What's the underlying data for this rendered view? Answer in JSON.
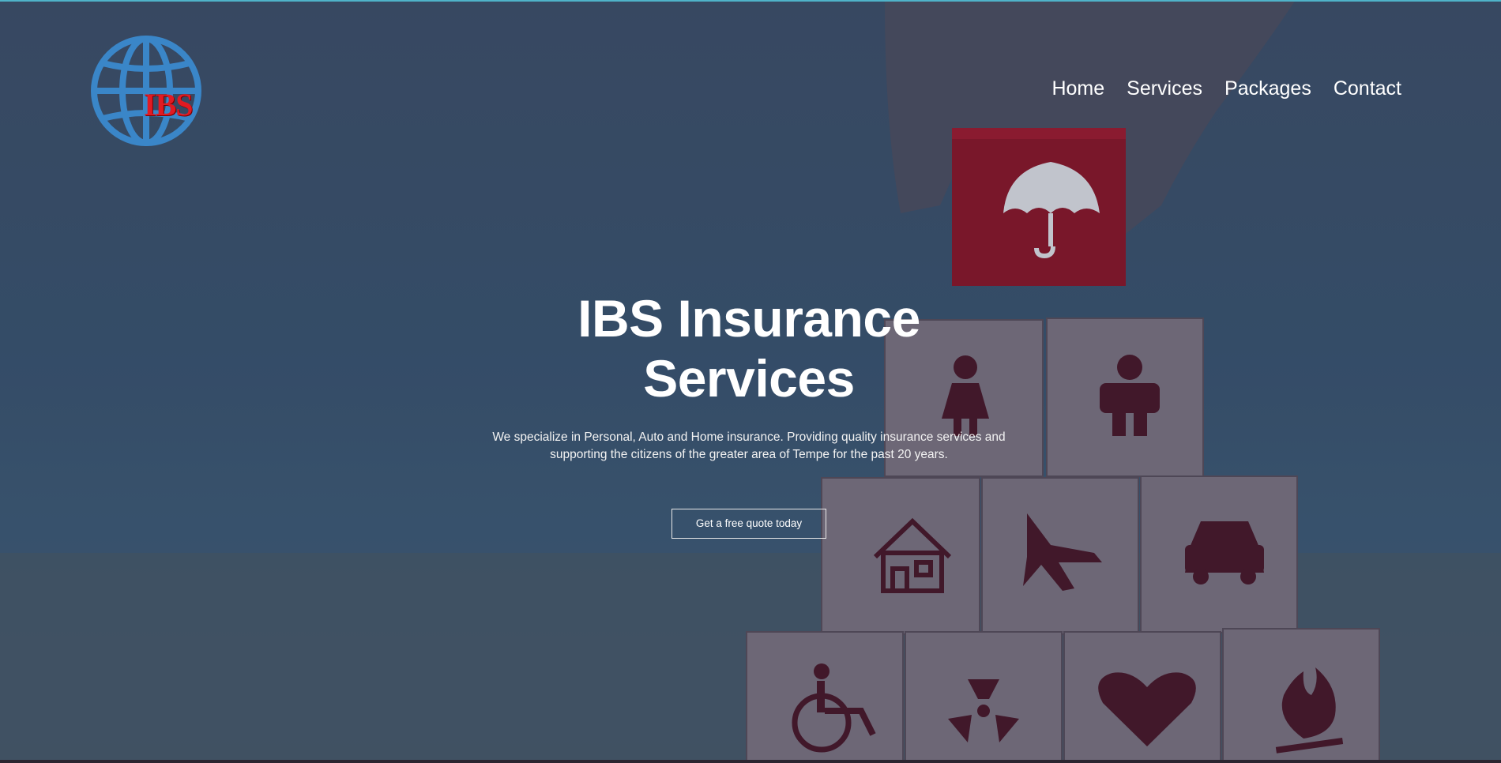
{
  "brand": {
    "logo_text": "IBS"
  },
  "nav": {
    "items": [
      "Home",
      "Services",
      "Packages",
      "Contact"
    ]
  },
  "hero": {
    "title": "IBS Insurance Services",
    "subtitle": "We specialize in Personal, Auto and Home insurance. Providing quality insurance services and supporting the citizens of the greater area of Tempe for the past 20 years.",
    "cta_label": "Get a free quote today"
  },
  "colors": {
    "logo_blue": "#3a86c8",
    "logo_red": "#e21a22",
    "block_red": "#8e1324",
    "icon_dark": "#4a1424"
  },
  "background_icons": [
    "umbrella-icon",
    "woman-icon",
    "man-icon",
    "house-icon",
    "airplane-icon",
    "car-icon",
    "wheelchair-icon",
    "radiation-icon",
    "heart-icon",
    "fire-icon"
  ]
}
